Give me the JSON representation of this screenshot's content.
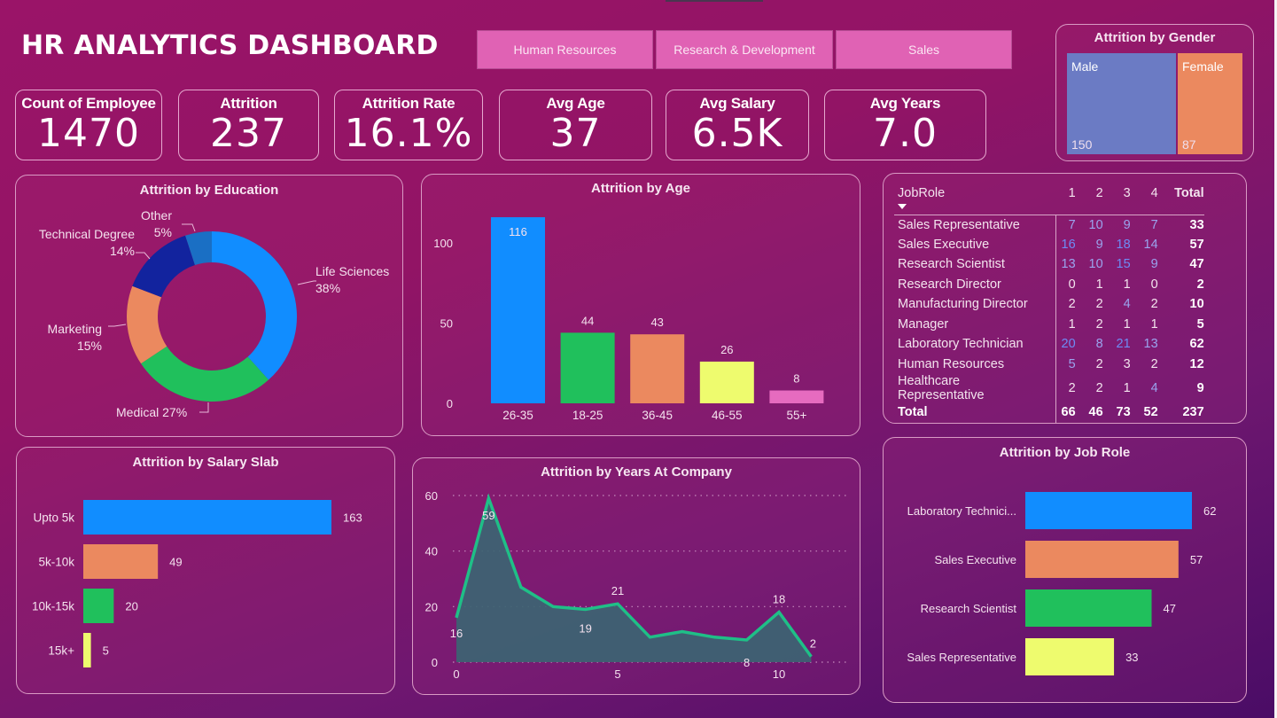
{
  "header": {
    "title": "HR ANALYTICS DASHBOARD"
  },
  "department_filters": [
    {
      "label": "Human Resources"
    },
    {
      "label": "Research & Development"
    },
    {
      "label": "Sales"
    }
  ],
  "kpis": [
    {
      "label": "Count of Employee",
      "value": "1470"
    },
    {
      "label": "Attrition",
      "value": "237"
    },
    {
      "label": "Attrition Rate",
      "value": "16.1%"
    },
    {
      "label": "Avg Age",
      "value": "37"
    },
    {
      "label": "Avg Salary",
      "value": "6.5K"
    },
    {
      "label": "Avg Years",
      "value": "7.0"
    }
  ],
  "colors": {
    "blue": "#118dff",
    "green": "#20c05c",
    "orange": "#eb895f",
    "yellow": "#eefb6e",
    "pink": "#e66bbf",
    "navy": "#12239e",
    "mid_blue": "#1a6fc4",
    "male": "#6b7bc4",
    "female": "#eb895f",
    "line": "#1fbf87",
    "area": "#3c6472"
  },
  "chart_data": [
    {
      "id": "gender",
      "type": "treemap",
      "title": "Attrition by Gender",
      "categories": [
        "Male",
        "Female"
      ],
      "values": [
        150,
        87
      ]
    },
    {
      "id": "education",
      "type": "pie",
      "title": "Attrition by Education",
      "categories": [
        "Life Sciences",
        "Medical",
        "Marketing",
        "Technical Degree",
        "Other"
      ],
      "values": [
        38,
        27,
        15,
        14,
        5
      ],
      "labels": [
        "38%",
        "27%",
        "15%",
        "14%",
        "5%"
      ],
      "donut": true
    },
    {
      "id": "age",
      "type": "bar",
      "title": "Attrition by Age",
      "categories": [
        "26-35",
        "18-25",
        "36-45",
        "46-55",
        "55+"
      ],
      "values": [
        116,
        44,
        43,
        26,
        8
      ],
      "yticks": [
        0,
        50,
        100
      ],
      "ylim": [
        0,
        120
      ],
      "xlabel": "",
      "ylabel": ""
    },
    {
      "id": "salary",
      "type": "bar",
      "orientation": "horizontal",
      "title": "Attrition by Salary Slab",
      "categories": [
        "Upto 5k",
        "5k-10k",
        "10k-15k",
        "15k+"
      ],
      "values": [
        163,
        49,
        20,
        5
      ]
    },
    {
      "id": "years",
      "type": "area",
      "title": "Attrition by Years At Company",
      "x": [
        0,
        1,
        2,
        3,
        4,
        5,
        6,
        7,
        8,
        9,
        10,
        11
      ],
      "values": [
        16,
        59,
        27,
        20,
        19,
        21,
        9,
        11,
        9,
        8,
        18,
        2
      ],
      "labeled_points": {
        "0": "16",
        "1": "59",
        "4": "19",
        "5": "21",
        "9": "8",
        "10": "18",
        "11": "2"
      },
      "xticks": [
        0,
        5,
        10
      ],
      "yticks": [
        0,
        20,
        40,
        60
      ],
      "ylim": [
        0,
        60
      ],
      "grid": true
    },
    {
      "id": "jobrole",
      "type": "bar",
      "orientation": "horizontal",
      "title": "Attrition by Job Role",
      "categories": [
        "Laboratory Technici...",
        "Sales Executive",
        "Research Scientist",
        "Sales Representative"
      ],
      "values": [
        62,
        57,
        47,
        33
      ]
    }
  ],
  "matrix": {
    "row_header": "JobRole",
    "columns": [
      "1",
      "2",
      "3",
      "4",
      "Total"
    ],
    "rows": [
      {
        "role": "Sales Representative",
        "values": [
          "7",
          "10",
          "9",
          "7"
        ],
        "total": "33"
      },
      {
        "role": "Sales Executive",
        "values": [
          "16",
          "9",
          "18",
          "14"
        ],
        "total": "57"
      },
      {
        "role": "Research Scientist",
        "values": [
          "13",
          "10",
          "15",
          "9"
        ],
        "total": "47"
      },
      {
        "role": "Research Director",
        "values": [
          "0",
          "1",
          "1",
          "0"
        ],
        "total": "2"
      },
      {
        "role": "Manufacturing Director",
        "values": [
          "2",
          "2",
          "4",
          "2"
        ],
        "total": "10"
      },
      {
        "role": "Manager",
        "values": [
          "1",
          "2",
          "1",
          "1"
        ],
        "total": "5"
      },
      {
        "role": "Laboratory Technician",
        "values": [
          "20",
          "8",
          "21",
          "13"
        ],
        "total": "62"
      },
      {
        "role": "Human Resources",
        "values": [
          "5",
          "2",
          "3",
          "2"
        ],
        "total": "12"
      },
      {
        "role": "Healthcare Representative",
        "values": [
          "2",
          "2",
          "1",
          "4"
        ],
        "total": "9"
      }
    ],
    "total_row": {
      "label": "Total",
      "values": [
        "66",
        "46",
        "73",
        "52"
      ],
      "total": "237"
    }
  }
}
